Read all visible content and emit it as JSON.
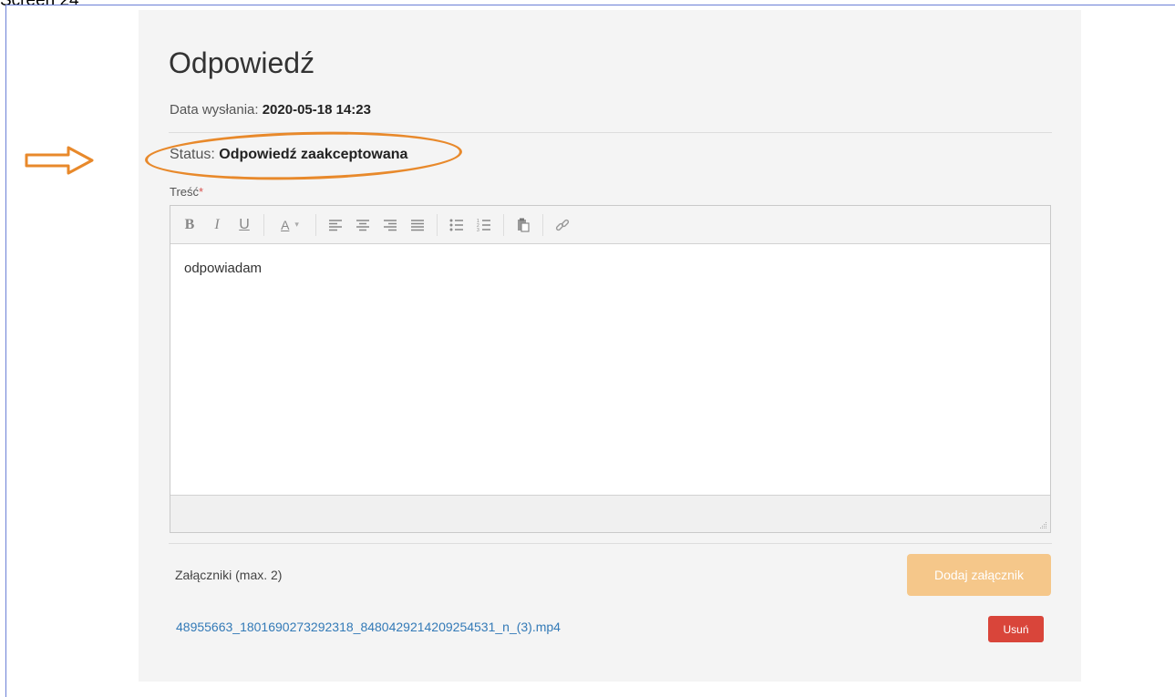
{
  "caption": "Screen 24",
  "annotation": {
    "arrow_color": "#e8892b",
    "oval_color": "#e8892b"
  },
  "panel": {
    "title": "Odpowiedź",
    "sent_label": "Data wysłania:",
    "sent_value": "2020-05-18 14:23",
    "status_label": "Status:",
    "status_value": "Odpowiedź zaakceptowana",
    "content_label": "Treść",
    "required_mark": "*",
    "editor": {
      "toolbar": [
        "bold-icon",
        "italic-icon",
        "underline-icon",
        "font-color-icon",
        "align-left-icon",
        "align-center-icon",
        "align-right-icon",
        "align-justify-icon",
        "bullet-list-icon",
        "numbered-list-icon",
        "paste-icon",
        "link-icon"
      ],
      "text": "odpowiadam"
    },
    "attachments_label": "Załączniki (max. 2)",
    "add_attachment_label": "Dodaj załącznik",
    "files": [
      {
        "name": "48955663_1801690273292318_8480429214209254531_n_(3).mp4",
        "delete_label": "Usuń"
      }
    ]
  },
  "colors": {
    "accent_orange": "#f5c78a",
    "danger": "#d9453a",
    "link": "#337ab7"
  }
}
